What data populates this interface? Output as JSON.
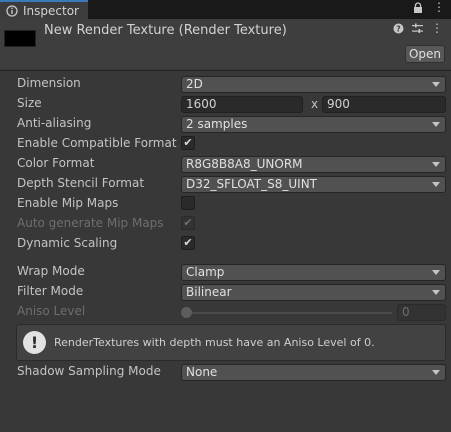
{
  "tab": {
    "label": "Inspector",
    "icons": [
      "lock-icon",
      "menu-icon"
    ]
  },
  "header": {
    "title": "New Render Texture (Render Texture)",
    "open_label": "Open",
    "icons": [
      "help-icon",
      "settings-icon",
      "overflow-menu-icon"
    ]
  },
  "props": {
    "dimension": {
      "label": "Dimension",
      "value": "2D"
    },
    "size": {
      "label": "Size",
      "width": "1600",
      "x": "x",
      "height": "900"
    },
    "anti_aliasing": {
      "label": "Anti-aliasing",
      "value": "2 samples"
    },
    "enable_compatible_format": {
      "label": "Enable Compatible Format",
      "checked": "✔"
    },
    "color_format": {
      "label": "Color Format",
      "value": "R8G8B8A8_UNORM"
    },
    "depth_stencil_format": {
      "label": "Depth Stencil Format",
      "value": "D32_SFLOAT_S8_UINT"
    },
    "enable_mip_maps": {
      "label": "Enable Mip Maps",
      "checked": ""
    },
    "auto_generate_mip_maps": {
      "label": "Auto generate Mip Maps",
      "checked": "✔"
    },
    "dynamic_scaling": {
      "label": "Dynamic Scaling",
      "checked": "✔"
    },
    "wrap_mode": {
      "label": "Wrap Mode",
      "value": "Clamp"
    },
    "filter_mode": {
      "label": "Filter Mode",
      "value": "Bilinear"
    },
    "aniso_level": {
      "label": "Aniso Level",
      "value": "0",
      "slider_fraction": 0
    },
    "shadow_sampling_mode": {
      "label": "Shadow Sampling Mode",
      "value": "None"
    }
  },
  "help": {
    "icon": "!",
    "text": "RenderTextures with depth must have an Aniso Level of 0."
  }
}
